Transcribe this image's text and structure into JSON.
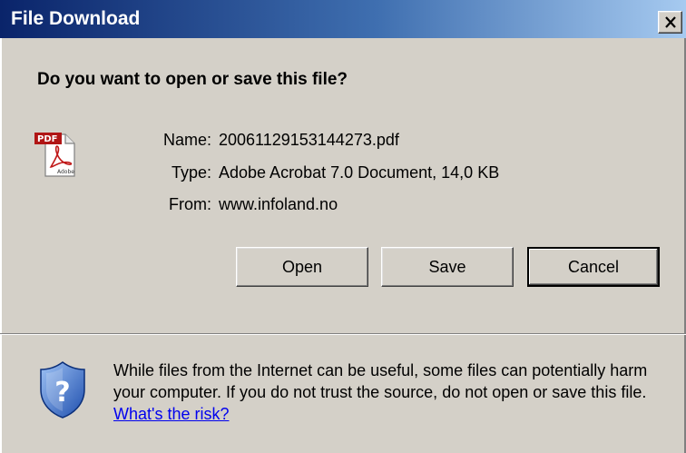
{
  "window": {
    "title": "File Download",
    "close_icon": "close-icon"
  },
  "dialog": {
    "question": "Do you want to open or save this file?",
    "file_icon": "pdf-file-icon",
    "fields": [
      {
        "label": "Name:",
        "value": "20061129153144273.pdf"
      },
      {
        "label": "Type:",
        "value": "Adobe Acrobat 7.0 Document, 14,0 KB"
      },
      {
        "label": "From:",
        "value": "www.infoland.no"
      }
    ],
    "buttons": {
      "open": "Open",
      "save": "Save",
      "cancel": "Cancel"
    }
  },
  "warning": {
    "icon": "security-shield-icon",
    "text": "While files from the Internet can be useful, some files can potentially harm your computer. If you do not trust the source, do not open or save this file.",
    "link_text": "What's the risk?"
  },
  "colors": {
    "titlebar_start": "#0a246a",
    "titlebar_end": "#a6caf0",
    "dialog_bg": "#d4d0c8",
    "link": "#0000ee"
  }
}
